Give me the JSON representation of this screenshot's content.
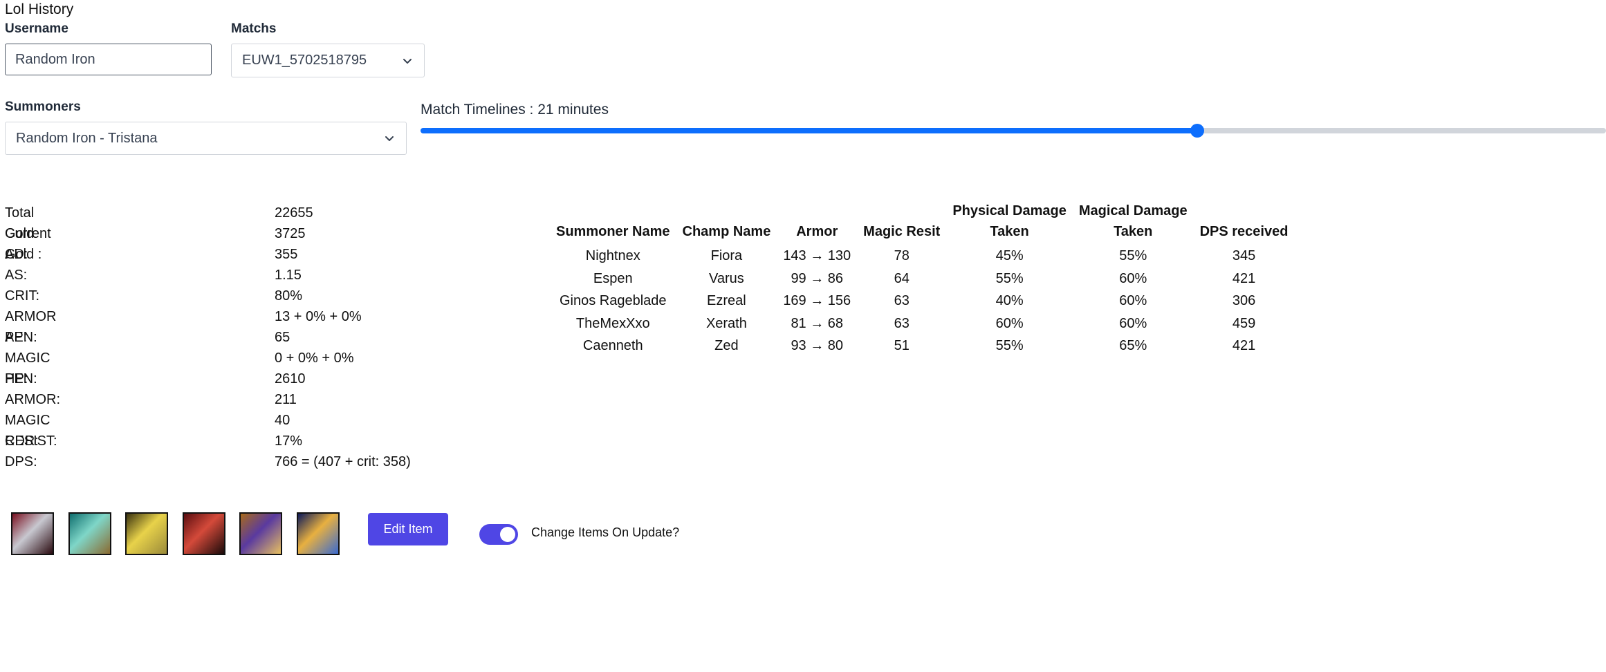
{
  "app": {
    "title": "Lol History"
  },
  "form": {
    "username_label": "Username",
    "username_value": "Random Iron",
    "matchs_label": "Matchs",
    "matchs_selected": "EUW1_5702518795",
    "summoners_label": "Summoners",
    "summoners_selected": "Random Iron - Tristana"
  },
  "timeline": {
    "label": "Match Timelines : 21 minutes",
    "position_fraction": 0.655
  },
  "stats": [
    {
      "label": "Total Gold :",
      "value": "22655"
    },
    {
      "label": "Current Gold :",
      "value": "3725"
    },
    {
      "label": "AD:",
      "value": "355"
    },
    {
      "label": "AS:",
      "value": "1.15"
    },
    {
      "label": "CRIT:",
      "value": "80%"
    },
    {
      "label": "ARMOR PEN:",
      "value": "13 + 0% + 0%"
    },
    {
      "label": "AP:",
      "value": "65"
    },
    {
      "label": "MAGIC PEN:",
      "value": "0 + 0% + 0%"
    },
    {
      "label": "HP:",
      "value": "2610"
    },
    {
      "label": "ARMOR:",
      "value": "211"
    },
    {
      "label": "MAGIC RESIST:",
      "value": "40"
    },
    {
      "label": "CDR:",
      "value": "17%"
    },
    {
      "label": "DPS:",
      "value": "766 = (407 + crit: 358)"
    }
  ],
  "summoner_table": {
    "headers": {
      "summoner": "Summoner Name",
      "champ": "Champ Name",
      "armor": "Armor",
      "mr": "Magic Resit",
      "phys_1": "Physical Damage",
      "phys_2": "Taken",
      "mag_1": "Magical Damage",
      "mag_2": "Taken",
      "dps": "DPS received"
    },
    "rows": [
      {
        "summoner": "Nightnex",
        "champ": "Fiora",
        "armor": "143 → 130",
        "mr": "78",
        "phys": "45%",
        "mag": "55%",
        "dps": "345"
      },
      {
        "summoner": "Espen",
        "champ": "Varus",
        "armor": "99 → 86",
        "mr": "64",
        "phys": "55%",
        "mag": "60%",
        "dps": "421"
      },
      {
        "summoner": "Ginos Rageblade",
        "champ": "Ezreal",
        "armor": "169 → 156",
        "mr": "63",
        "phys": "40%",
        "mag": "60%",
        "dps": "306"
      },
      {
        "summoner": "TheMexXxo",
        "champ": "Xerath",
        "armor": "81 → 68",
        "mr": "63",
        "phys": "60%",
        "mag": "60%",
        "dps": "459"
      },
      {
        "summoner": "Caenneth",
        "champ": "Zed",
        "armor": "93 → 80",
        "mr": "51",
        "phys": "55%",
        "mag": "65%",
        "dps": "421"
      }
    ]
  },
  "items": [
    {
      "icon": "crimson-blade-item-icon",
      "colors": [
        "#7a1020",
        "#c8c8d0",
        "#2a0a10"
      ]
    },
    {
      "icon": "teal-cannon-item-icon",
      "colors": [
        "#0f6e6e",
        "#7fd6c8",
        "#8a6a30"
      ]
    },
    {
      "icon": "lightning-dagger-item-icon",
      "colors": [
        "#3a3210",
        "#e8d24a",
        "#9a8a3a"
      ]
    },
    {
      "icon": "red-greatsword-item-icon",
      "colors": [
        "#5a0d10",
        "#d44a3a",
        "#1a0a0a"
      ]
    },
    {
      "icon": "purple-shield-item-icon",
      "colors": [
        "#a86a1a",
        "#5a3aa0",
        "#e8c060"
      ]
    },
    {
      "icon": "hourglass-item-icon",
      "colors": [
        "#0d1a5a",
        "#e8b040",
        "#3a6ad0"
      ]
    }
  ],
  "actions": {
    "edit_item_label": "Edit Item",
    "change_items_label": "Change Items On Update?",
    "change_items_enabled": true
  },
  "colors": {
    "accent": "#4f46e5",
    "slider": "#0d6efd"
  }
}
